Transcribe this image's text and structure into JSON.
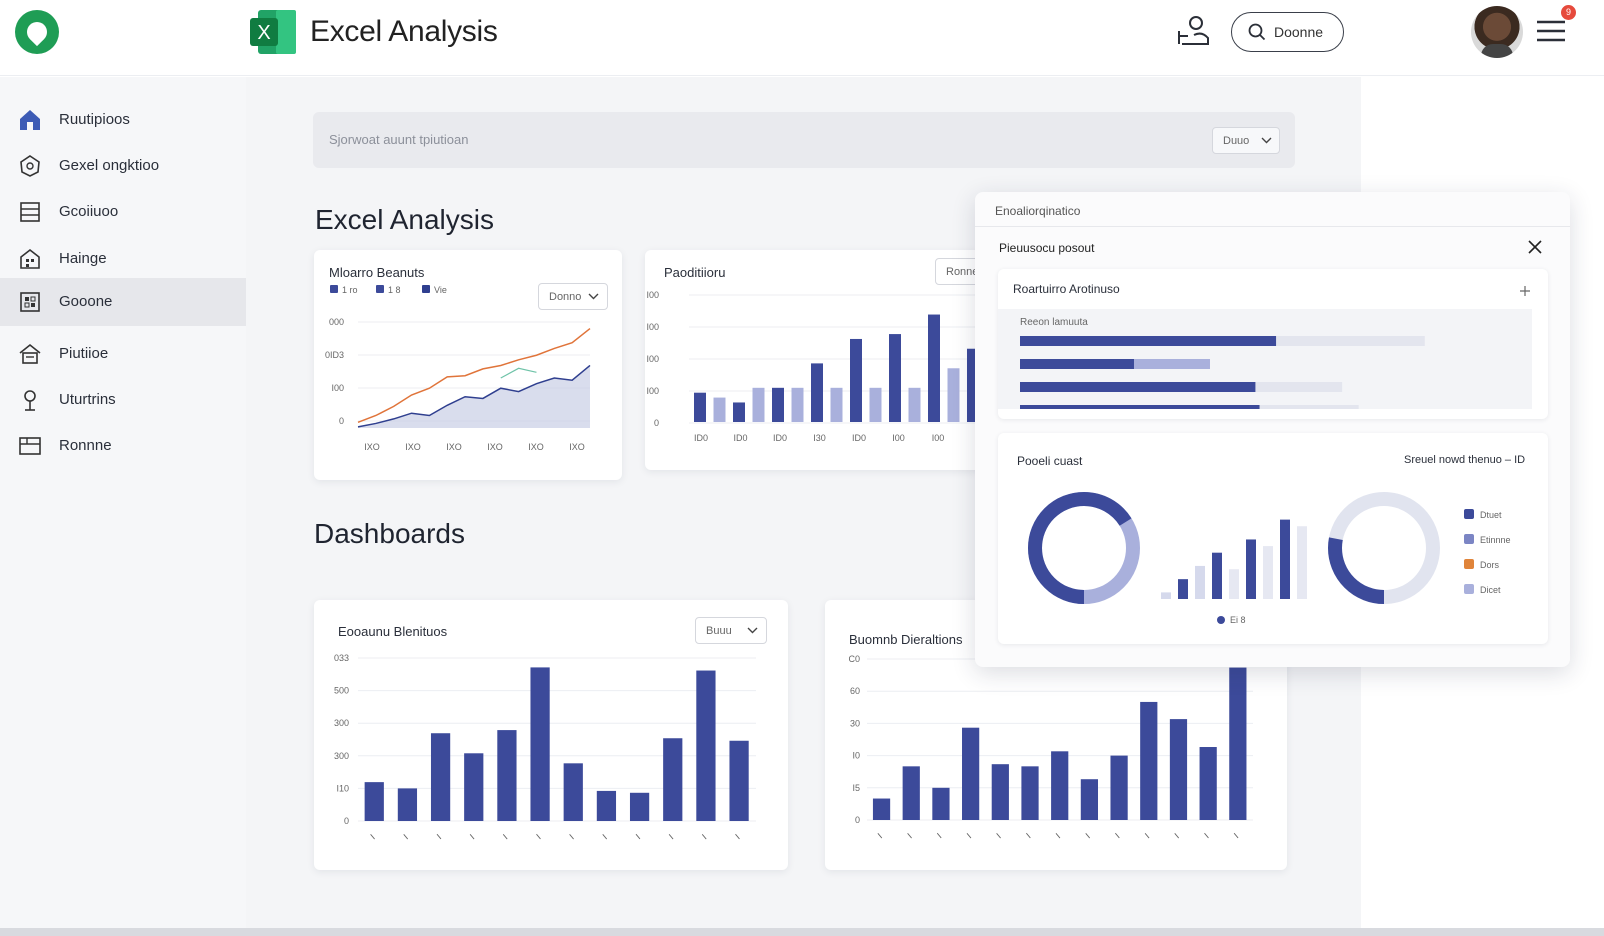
{
  "header": {
    "app_title": "Excel Analysis",
    "search_label": "Doonne",
    "notification_count": "9"
  },
  "sidebar": {
    "items": [
      {
        "label": "Ruutipioos",
        "icon": "home-icon"
      },
      {
        "label": "Gexel ongktioo",
        "icon": "shield-icon"
      },
      {
        "label": "Gcoiiuoo",
        "icon": "list-icon"
      },
      {
        "label": "Hainge",
        "icon": "building-icon"
      },
      {
        "label": "Gooone",
        "icon": "grid-icon",
        "active": true
      },
      {
        "label": "Piutiioe",
        "icon": "house-icon"
      },
      {
        "label": "Uturtrins",
        "icon": "pin-icon"
      },
      {
        "label": "Ronnne",
        "icon": "table-icon"
      }
    ]
  },
  "main": {
    "search_placeholder": "Sjorwoat auunt tpiutioan",
    "search_dropdown": "Duuo",
    "section_excel": "Excel Analysis",
    "section_dashboards": "Dashboards"
  },
  "cards": {
    "line": {
      "title": "Mloarro Beanuts",
      "dropdown": "Donno",
      "legend": [
        "1 ro",
        "1 8",
        "Vie"
      ]
    },
    "bar_top": {
      "title": "Paoditiioru",
      "dropdown": "Ronne"
    },
    "bar_bottom_left": {
      "title": "Eooaunu Blenituos",
      "dropdown": "Buuu"
    },
    "bar_bottom_right": {
      "title": "Buomnb Dieraltions"
    }
  },
  "panel": {
    "top_label": "Enoaliorqinatico",
    "title": "Pieuusocu posout",
    "hbar_card": {
      "title": "Roartuirro Arotinuso",
      "subtitle": "Reeon lamuuta"
    },
    "donut_card": {
      "title": "Pooeli cuast",
      "right_title": "Sreuel nowd thenuo – ID",
      "mid_legend": "Ei 8",
      "legend": [
        {
          "label": "Dtuet",
          "color": "#3c4a9a"
        },
        {
          "label": "Etinnne",
          "color": "#7b85c4"
        },
        {
          "label": "Dors",
          "color": "#e0843a"
        },
        {
          "label": "Dicet",
          "color": "#a9b0dc"
        }
      ]
    }
  },
  "colors": {
    "bar_dark": "#3c4a9a",
    "bar_light": "#a9b0dc",
    "line_orange": "#e0743a",
    "line_blue": "#2f3f8f",
    "line_teal": "#6fc3a8",
    "excel_green": "#1f8c47"
  },
  "chart_data": [
    {
      "type": "line",
      "title": "Mloarro Beanuts",
      "categories": [
        "IXO",
        "IXO",
        "IXO",
        "IXO",
        "IXO",
        "IXO"
      ],
      "yticks": [
        "000",
        "0ID3",
        "I00",
        "0"
      ],
      "series": [
        {
          "name": "1 ro",
          "values": [
            10,
            22,
            38,
            58,
            70,
            90,
            92,
            104,
            110,
            120,
            128,
            140,
            150,
            175
          ]
        },
        {
          "name": "1 8",
          "values": [
            2,
            8,
            16,
            26,
            22,
            40,
            55,
            52,
            70,
            64,
            78,
            88,
            84,
            110
          ]
        },
        {
          "name": "Vie",
          "values": [
            null,
            null,
            null,
            null,
            null,
            null,
            null,
            null,
            88,
            105,
            98,
            null,
            null,
            null
          ]
        }
      ]
    },
    {
      "type": "bar",
      "title": "Paoditiioru",
      "categories": [
        "ID0",
        "ID0",
        "ID0",
        "I30",
        "ID0",
        "I00",
        "I00"
      ],
      "yticks": [
        "I00",
        "I00",
        "I00",
        "I00",
        "0"
      ],
      "series": [
        {
          "name": "dark",
          "values": [
            30,
            20,
            35,
            60,
            85,
            90,
            110,
            75,
            30,
            125,
            80,
            90
          ]
        },
        {
          "name": "light",
          "values": [
            25,
            35,
            35,
            35,
            35,
            35,
            55,
            35,
            35,
            55,
            70,
            115
          ]
        }
      ]
    },
    {
      "type": "bar",
      "title": "Eooaunu Blenituos",
      "categories": [
        "I",
        "I",
        "I",
        "I",
        "I",
        "I",
        "I",
        "I",
        "I",
        "I",
        "I",
        "I"
      ],
      "yticks": [
        "033",
        "500",
        "300",
        "300",
        "I10",
        "0"
      ],
      "values": [
        62,
        52,
        140,
        108,
        145,
        245,
        92,
        48,
        45,
        132,
        240,
        128
      ]
    },
    {
      "type": "bar",
      "title": "Buomnb Dieraltions",
      "categories": [
        "I",
        "I",
        "I",
        "I",
        "I",
        "I",
        "I",
        "I",
        "I",
        "I",
        "I",
        "I",
        "I",
        "I"
      ],
      "yticks": [
        "C0",
        "60",
        "30",
        "I0",
        "I5",
        "0"
      ],
      "values": [
        10,
        25,
        15,
        43,
        26,
        25,
        32,
        19,
        30,
        55,
        47,
        34,
        71
      ]
    },
    {
      "type": "bar",
      "title": "Roartuirro Arotinuso",
      "values": [
        0.62,
        0.46,
        0.57,
        0.58
      ],
      "background": [
        0.98,
        0.46,
        0.78,
        0.82
      ]
    },
    {
      "type": "pie",
      "title": "Pooeli cuast",
      "values": [
        66,
        34
      ]
    },
    {
      "type": "bar",
      "values": [
        2,
        6,
        10,
        14,
        9,
        18,
        16,
        24,
        22
      ]
    },
    {
      "type": "pie",
      "title": "Sreuel nowd thenuo – ID",
      "values": [
        28,
        72
      ]
    }
  ]
}
